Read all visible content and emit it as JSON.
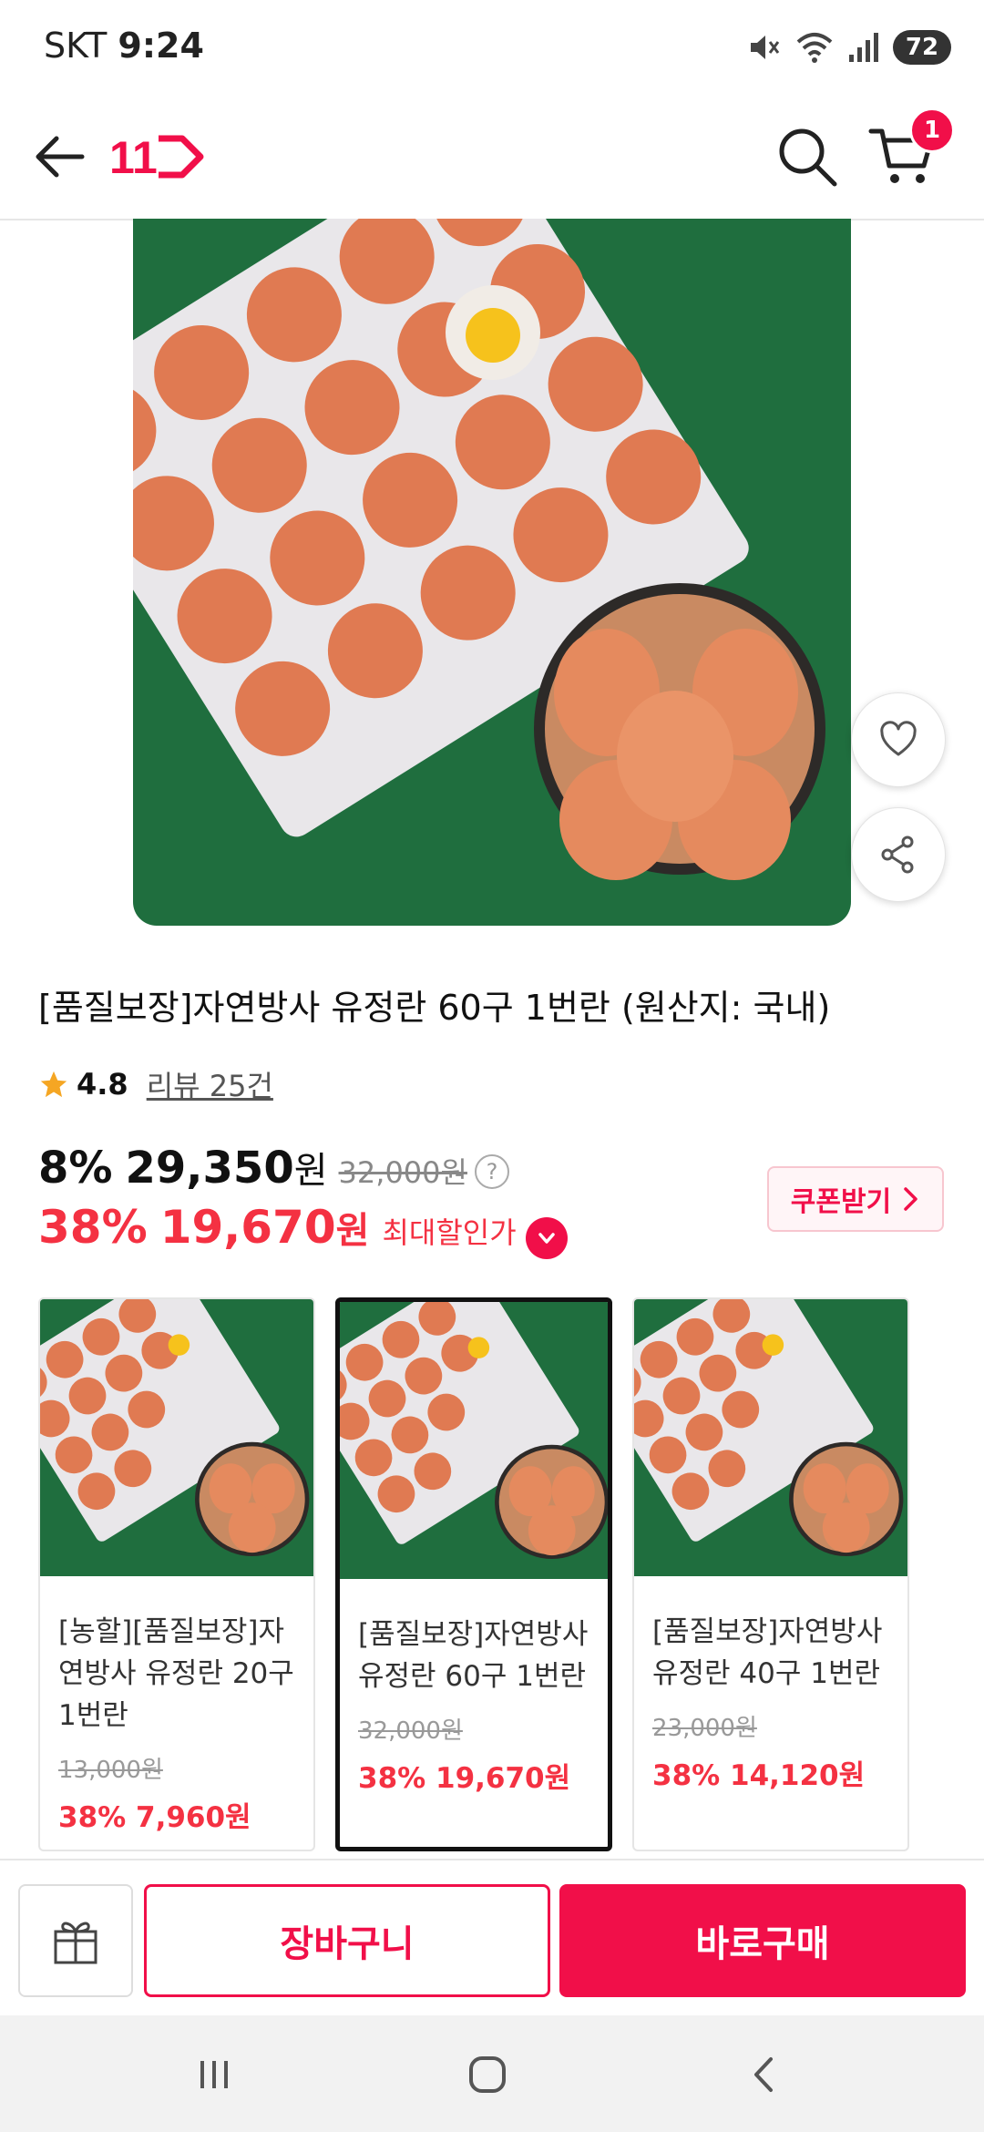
{
  "status_bar": {
    "carrier": "SKT",
    "time": "9:24",
    "battery": "72"
  },
  "header": {
    "logo_text": "11",
    "cart_count": "1"
  },
  "product": {
    "title": "[품질보장]자연방사 유정란 60구 1번란 (원산지: 국내)",
    "rating": "4.8",
    "review_link": "리뷰 25건",
    "price": {
      "discount_rate": "8%",
      "price": "29,350",
      "won": "원",
      "original": "32,000원",
      "max_rate": "38%",
      "max_price": "19,670",
      "max_won": "원",
      "max_label": "최대할인가"
    },
    "coupon_label": "쿠폰받기"
  },
  "options": [
    {
      "name": "[농할][품질보장]자연방사 유정란 20구 1번란",
      "original": "13,000원",
      "sale": "38% 7,960원",
      "selected": false
    },
    {
      "name": "[품질보장]자연방사 유정란 60구 1번란",
      "original": "32,000원",
      "sale": "38% 19,670원",
      "selected": true
    },
    {
      "name": "[품질보장]자연방사 유정란 40구 1번란",
      "original": "23,000원",
      "sale": "38% 14,120원",
      "selected": false
    }
  ],
  "bottom_bar": {
    "cart_button": "장바구니",
    "buy_button": "바로구매"
  },
  "colors": {
    "accent": "#f10f49",
    "sale_red": "#f43142",
    "hero_green": "#1f6e3e",
    "egg": "#e07a52"
  },
  "icons": [
    "back-arrow-icon",
    "search-icon",
    "cart-icon",
    "heart-icon",
    "share-icon",
    "gift-icon",
    "chevron-right-icon",
    "chevron-down-icon",
    "help-icon",
    "star-icon"
  ]
}
